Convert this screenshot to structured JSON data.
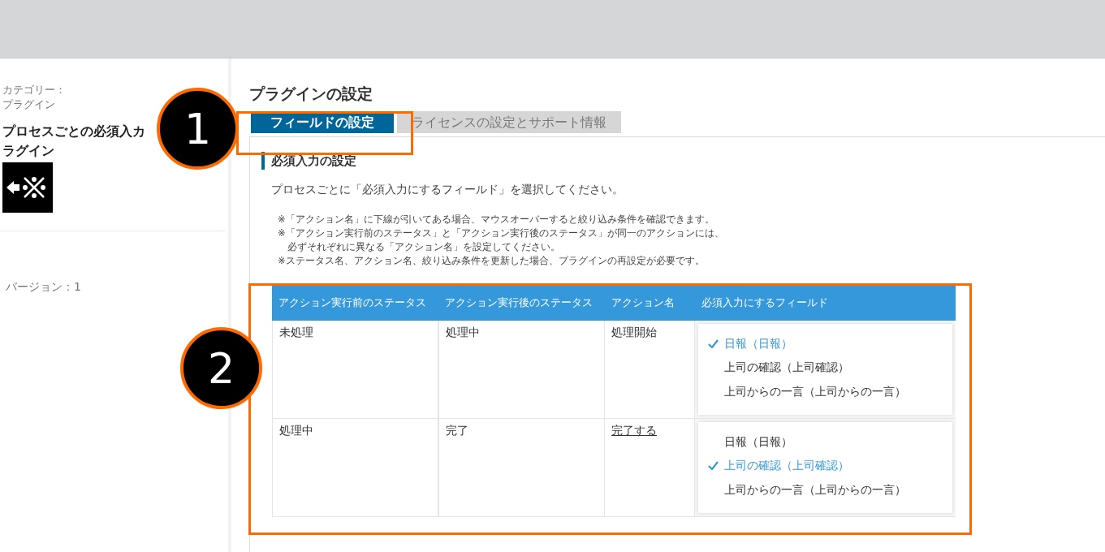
{
  "sidebar": {
    "category_label": "カテゴリー：",
    "category": "プラグイン",
    "title_lines": [
      "プロセスごとの必須入カ",
      "ラグイン"
    ],
    "version": "バージョン：1"
  },
  "page_title": "プラグインの設定",
  "tabs": [
    {
      "label": "フィールドの設定",
      "selected": true
    },
    {
      "label": "ライセンスの設定とサポート情報",
      "selected": false
    }
  ],
  "section": {
    "heading": "必須入力の設定",
    "intro": "プロセスごとに「必須入力にするフィールド」を選択してください。",
    "notes": [
      "※「アクション名」に下線が引いてある場合、マウスオーバーすると絞り込み条件を確認できます。",
      "※「アクション実行前のステータス」と「アクション実行後のステータス」が同一のアクションには、",
      "　必ずそれぞれに異なる「アクション名」を設定してください。",
      "※ステータス名、アクション名、絞り込み条件を更新した場合、プラグインの再設定が必要です。"
    ]
  },
  "table": {
    "columns": [
      "アクション実行前のステータス",
      "アクション実行後のステータス",
      "アクション名",
      "必須入力にするフィールド"
    ],
    "rows": [
      {
        "before": "未処理",
        "after": "処理中",
        "action": "処理開始",
        "action_underlined": false,
        "fields": [
          {
            "label": "日報（日報）",
            "selected": true
          },
          {
            "label": "上司の確認（上司確認）",
            "selected": false
          },
          {
            "label": "上司からの一言（上司からの一言）",
            "selected": false
          }
        ]
      },
      {
        "before": "処理中",
        "after": "完了",
        "action": "完了する",
        "action_underlined": true,
        "fields": [
          {
            "label": "日報（日報）",
            "selected": false
          },
          {
            "label": "上司の確認（上司確認）",
            "selected": true
          },
          {
            "label": "上司からの一言（上司からの一言）",
            "selected": false
          }
        ]
      }
    ]
  },
  "callouts": [
    "1",
    "2"
  ]
}
